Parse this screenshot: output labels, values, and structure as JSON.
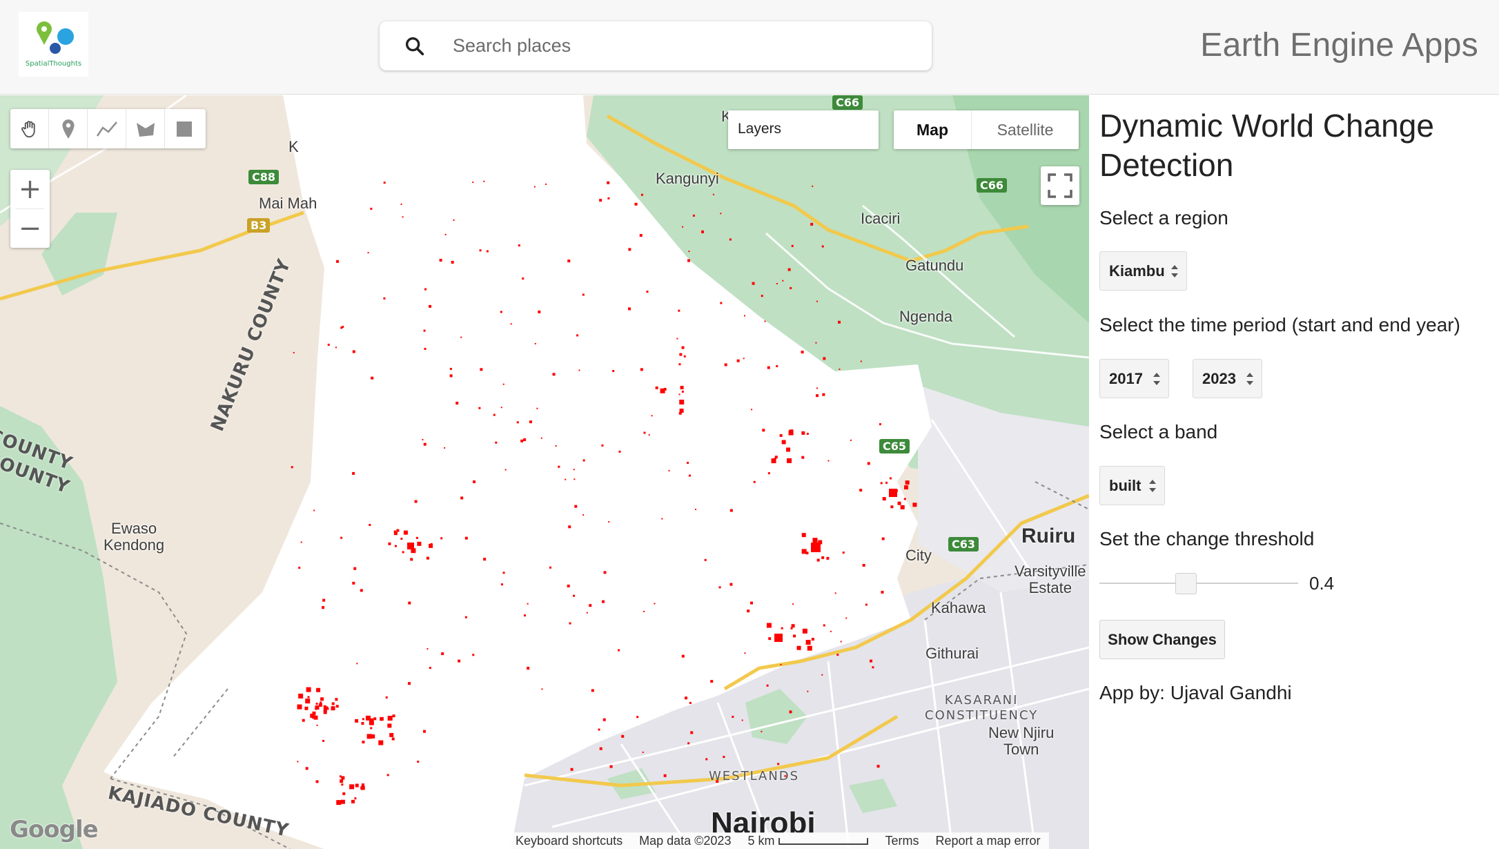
{
  "header": {
    "logo_text": "SpatialThoughts",
    "search": {
      "placeholder": "Search places",
      "value": ""
    },
    "brand": "Earth Engine Apps"
  },
  "map": {
    "controls": {
      "draw_tools": [
        "hand-icon",
        "marker-icon",
        "line-icon",
        "polygon-icon",
        "rectangle-icon"
      ],
      "zoom_in": "+",
      "zoom_out": "−",
      "layers_label": "Layers",
      "maptype": {
        "map_label": "Map",
        "satellite_label": "Satellite",
        "selected": "Map"
      }
    },
    "places": {
      "kangunyi": "Kangunyi",
      "icaciri": "Icaciri",
      "gatundu": "Gatundu",
      "ngenda": "Ngenda",
      "mai_mahiu": "Mai Mah",
      "ruiru": "Ruiru",
      "city": "City",
      "varsityville": "Varsityville\nEstate",
      "kahawa": "Kahawa",
      "githurai": "Githurai",
      "new_njiru": "New Njiru\nTown",
      "ewaso": "Ewaso\nKendong",
      "nairobi": "Nairobi",
      "westlands": "WESTLANDS",
      "kasarani": "KASARANI\nCONSTITUENCY",
      "k_top": "K",
      "k_left": "K"
    },
    "counties": {
      "nakuru": "NAKURU COUNTY",
      "county1": "COUNTY",
      "county2": "COUNTY",
      "kajiado": "KAJIADO COUNTY"
    },
    "roads": {
      "c66_top": "C66",
      "c66_right": "C66",
      "c88": "C88",
      "b3": "B3",
      "c65": "C65",
      "c63": "C63"
    },
    "google_logo": "Google",
    "attribution": {
      "shortcuts": "Keyboard shortcuts",
      "map_data": "Map data ©2023",
      "scale": "5 km",
      "terms": "Terms",
      "report": "Report a map error"
    },
    "change_pixel_color": "#ff0000"
  },
  "panel": {
    "title": "Dynamic World Change Detection",
    "region_label": "Select a region",
    "region_value": "Kiambu",
    "period_label": "Select the time period (start and end year)",
    "start_year": "2017",
    "end_year": "2023",
    "band_label": "Select a band",
    "band_value": "built",
    "threshold_label": "Set the change threshold",
    "threshold_value": "0.4",
    "threshold_fraction": 0.4,
    "button_label": "Show Changes",
    "credit": "App by: Ujaval Gandhi"
  }
}
